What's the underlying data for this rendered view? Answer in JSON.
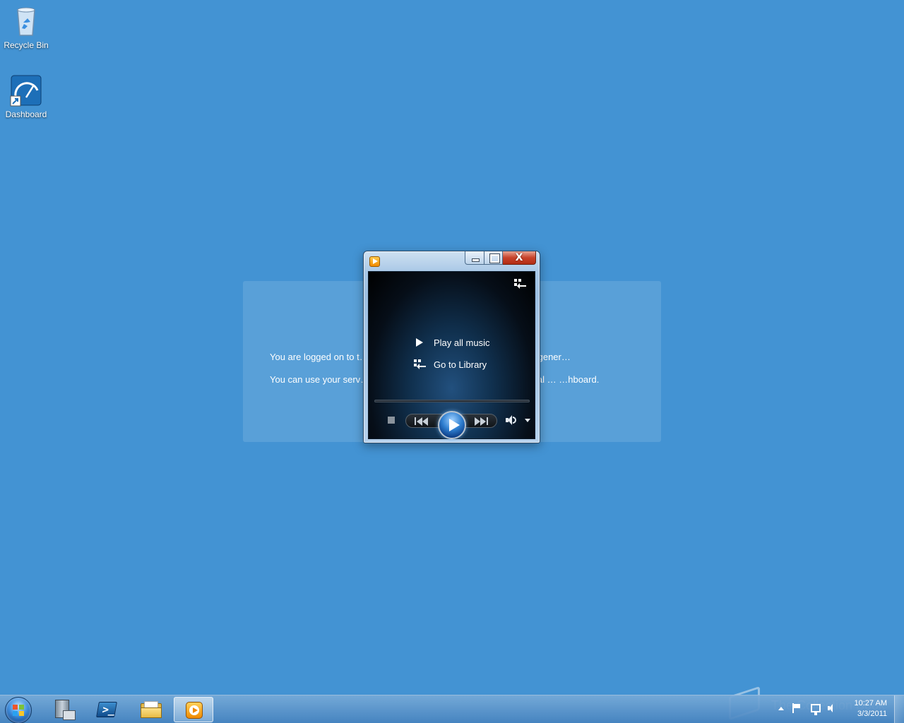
{
  "desktop": {
    "icons": [
      {
        "label": "Recycle Bin"
      },
      {
        "label": "Dashboard"
      }
    ],
    "background_color": "#4393d3"
  },
  "welcome_panel": {
    "paragraph_1": "You are logged on to t… …urity risks, do not use your server as a gener…",
    "paragraph_2": "You can use your serv… …tools for advanced tasks, but for general … …hboard."
  },
  "media_player": {
    "menu": {
      "play_all": "Play all music",
      "go_to_library": "Go to Library"
    },
    "caption_close": "X",
    "icons": {
      "app": "windows-media-player-icon",
      "switch": "switch-to-library-icon",
      "stop": "stop-icon",
      "previous": "previous-icon",
      "play": "play-icon",
      "next": "next-icon",
      "volume": "volume-icon",
      "dropdown": "dropdown-arrow-icon"
    },
    "accent": "#2f7fd0"
  },
  "taskbar": {
    "buttons": [
      {
        "name": "start",
        "icon": "windows-start-orb-icon"
      },
      {
        "name": "server-manager",
        "icon": "server-manager-icon"
      },
      {
        "name": "powershell",
        "icon": "powershell-icon",
        "glyph": ">_"
      },
      {
        "name": "windows-explorer",
        "icon": "folder-icon"
      },
      {
        "name": "windows-media-player",
        "icon": "windows-media-player-icon",
        "active": true
      }
    ],
    "tray": {
      "time": "10:27 AM",
      "date": "3/3/2011"
    }
  },
  "watermark": {
    "text": "The Collection Book"
  }
}
